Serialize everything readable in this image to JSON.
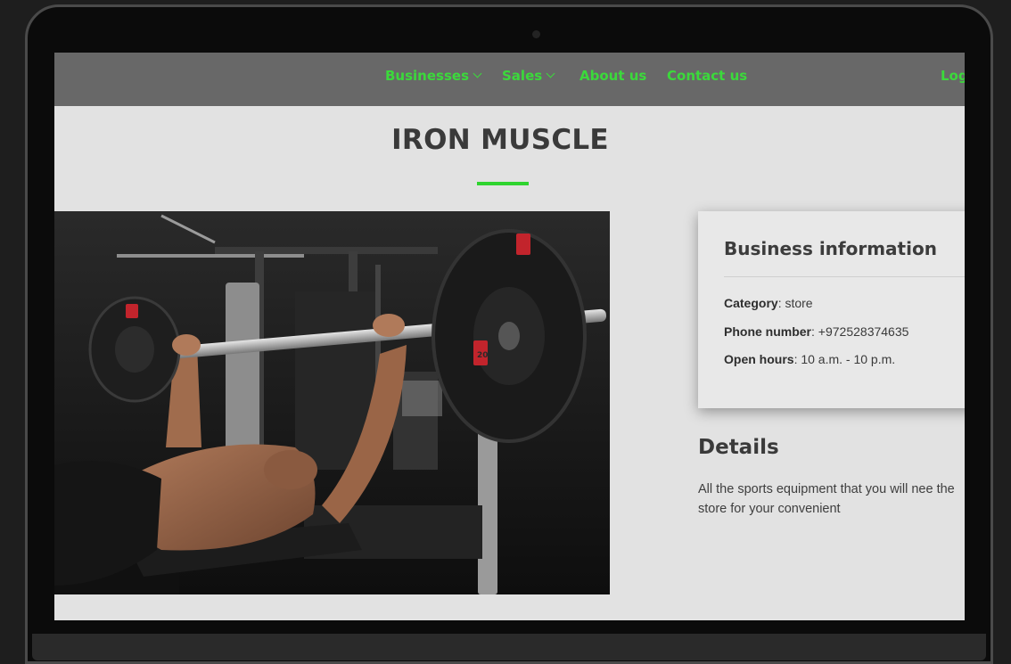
{
  "nav": {
    "items": [
      {
        "label": "Businesses",
        "has_dropdown": true
      },
      {
        "label": "Sales",
        "has_dropdown": true
      },
      {
        "label": "About us",
        "has_dropdown": false
      },
      {
        "label": "Contact us",
        "has_dropdown": false
      }
    ],
    "login_label": "Log",
    "link_color": "#3bd93b"
  },
  "page": {
    "title": "IRON MUSCLE",
    "accent_color": "#2fd42f"
  },
  "photo": {
    "plate_label": "20"
  },
  "business_info": {
    "heading": "Business information",
    "category_label": "Category",
    "category_value": "store",
    "phone_label": "Phone number",
    "phone_value": "+972528374635",
    "hours_label": "Open hours",
    "hours_value": "10 a.m. - 10 p.m."
  },
  "details": {
    "heading": "Details",
    "text": "All the sports equipment that you will nee the store for your convenient"
  }
}
